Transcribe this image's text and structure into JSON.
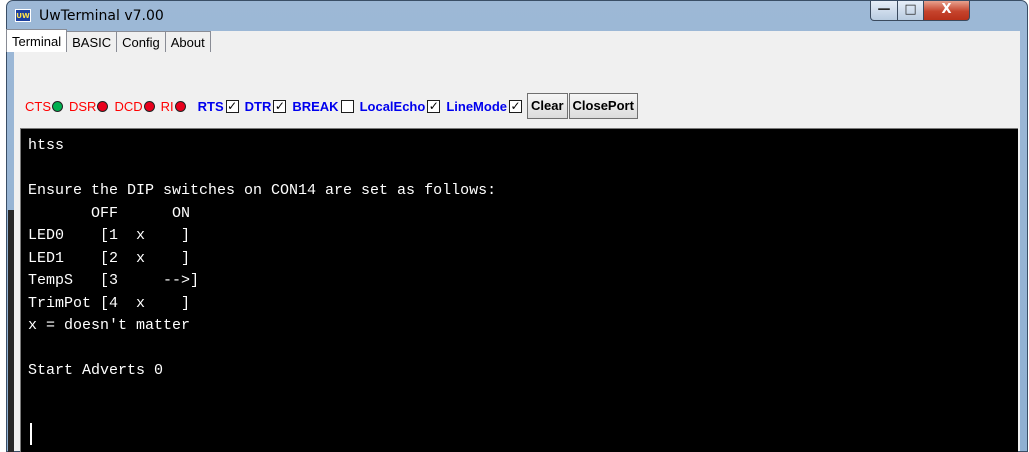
{
  "window": {
    "title": "UwTerminal v7.00",
    "icon_text": "UW",
    "controls": {
      "minimize": "—",
      "maximize": "□",
      "close": "X"
    }
  },
  "tabs": [
    {
      "label": "Terminal",
      "active": true
    },
    {
      "label": "BASIC",
      "active": false
    },
    {
      "label": "Config",
      "active": false
    },
    {
      "label": "About",
      "active": false
    }
  ],
  "toolbar": {
    "lamps": [
      {
        "label": "CTS",
        "color": "#00b050"
      },
      {
        "label": "DSR",
        "color": "#e8001c"
      },
      {
        "label": "DCD",
        "color": "#e8001c"
      },
      {
        "label": "RI",
        "color": "#e8001c"
      }
    ],
    "checkboxes": [
      {
        "label": "RTS",
        "checked": true
      },
      {
        "label": "DTR",
        "checked": true
      },
      {
        "label": "BREAK",
        "checked": false
      },
      {
        "label": "LocalEcho",
        "checked": true
      },
      {
        "label": "LineMode",
        "checked": true
      }
    ],
    "check_mark": "✓",
    "clear_label": "Clear",
    "closeport_label": "ClosePort"
  },
  "terminal": {
    "lines": [
      "htss",
      "",
      "Ensure the DIP switches on CON14 are set as follows:",
      "       OFF      ON",
      "LED0    [1  x    ]",
      "LED1    [2  x    ]",
      "TempS   [3     -->]",
      "TrimPot [4  x    ]",
      "x = doesn't matter",
      "",
      "Start Adverts 0"
    ]
  }
}
